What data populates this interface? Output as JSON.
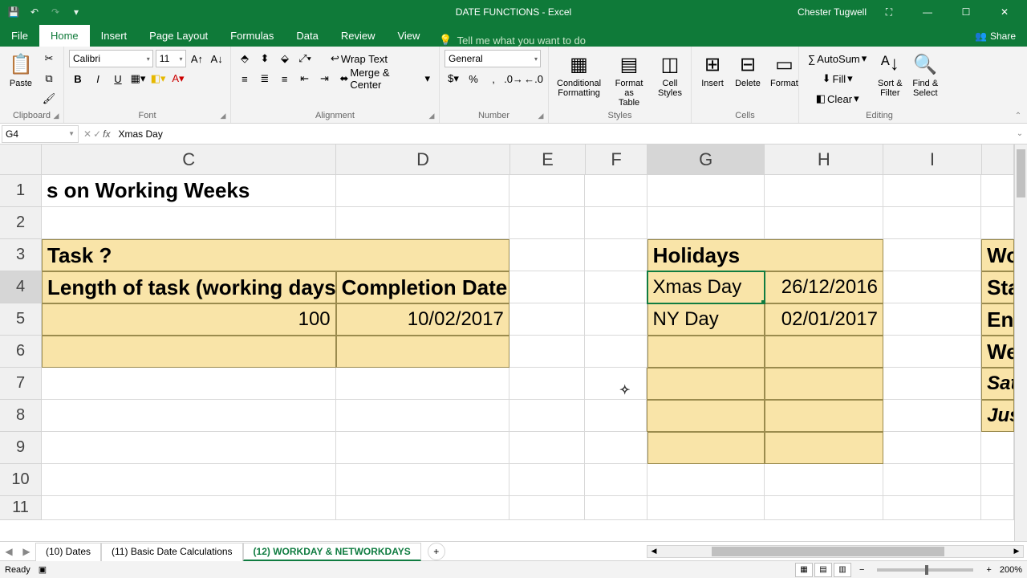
{
  "title": "DATE FUNCTIONS - Excel",
  "user": "Chester Tugwell",
  "tabs": {
    "file": "File",
    "home": "Home",
    "insert": "Insert",
    "pagelayout": "Page Layout",
    "formulas": "Formulas",
    "data": "Data",
    "review": "Review",
    "view": "View",
    "tellme": "Tell me what you want to do",
    "share": "Share"
  },
  "ribbon": {
    "clipboard": {
      "label": "Clipboard",
      "paste": "Paste"
    },
    "font": {
      "label": "Font",
      "name": "Calibri",
      "size": "11"
    },
    "alignment": {
      "label": "Alignment",
      "wrap": "Wrap Text",
      "merge": "Merge & Center"
    },
    "number": {
      "label": "Number",
      "format": "General"
    },
    "styles": {
      "label": "Styles",
      "cond": "Conditional\nFormatting",
      "table": "Format as\nTable",
      "cells": "Cell\nStyles"
    },
    "cells": {
      "label": "Cells",
      "insert": "Insert",
      "delete": "Delete",
      "format": "Format"
    },
    "editing": {
      "label": "Editing",
      "sum": "AutoSum",
      "fill": "Fill",
      "clear": "Clear",
      "sort": "Sort &\nFilter",
      "find": "Find &\nSelect"
    }
  },
  "name_box": "G4",
  "formula": "Xmas Day",
  "cols": [
    "C",
    "D",
    "E",
    "F",
    "G",
    "H",
    "I"
  ],
  "rows": [
    "1",
    "2",
    "3",
    "4",
    "5",
    "6",
    "7",
    "8",
    "9",
    "10",
    "11"
  ],
  "cells": {
    "c1": "s on Working Weeks",
    "c3": "Task ?",
    "c4": "Length of task (working days)",
    "d4": "Completion Date",
    "c5": "100",
    "d5": "10/02/2017",
    "g3": "Holidays",
    "g4": "Xmas Day",
    "h4": "26/12/2016",
    "g5": "NY Day",
    "h5": "02/01/2017",
    "j3": "Wo",
    "j4": "Sta",
    "j5": "Enc",
    "j6": "We",
    "j7": "Sat",
    "j8": "Jus"
  },
  "sheet_tabs": {
    "t1": "(10) Dates",
    "t2": "(11) Basic Date Calculations",
    "t3": "(12) WORKDAY & NETWORKDAYS"
  },
  "status": {
    "ready": "Ready",
    "zoom": "200%"
  }
}
